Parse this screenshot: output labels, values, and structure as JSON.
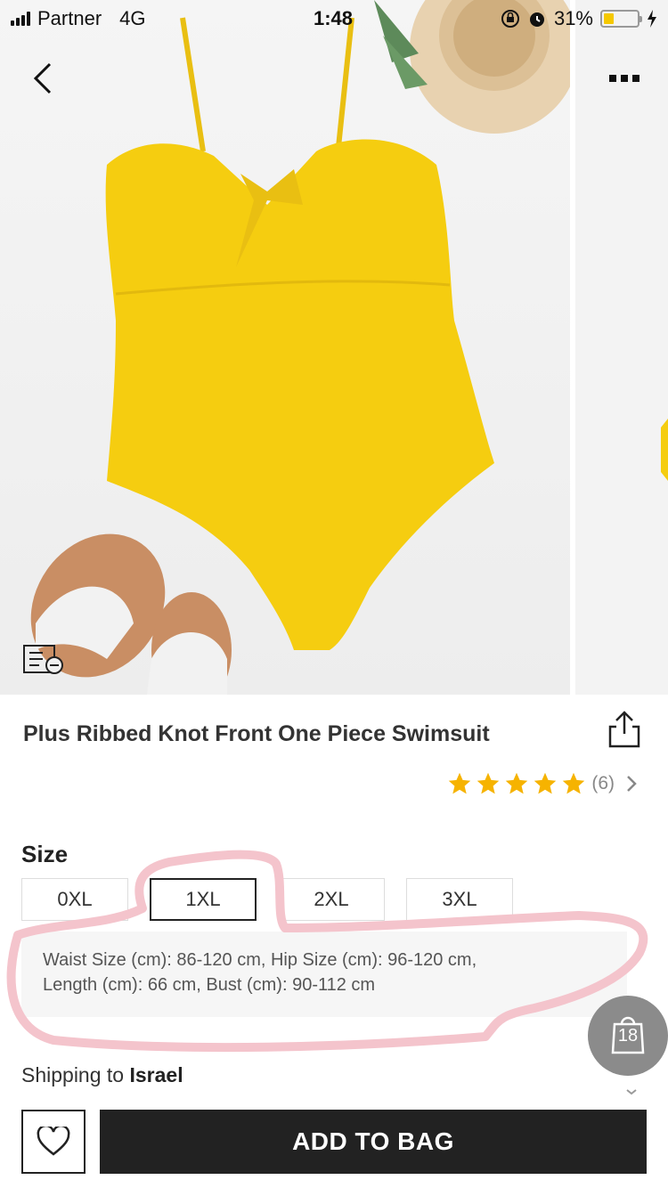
{
  "status_bar": {
    "carrier": "Partner",
    "network": "4G",
    "time": "1:48",
    "battery_percent": "31%",
    "battery_level": 0.31,
    "battery_color": "#f5c800"
  },
  "hero": {
    "back_icon": "chevron-left-icon",
    "more_icon": "more-dots-icon",
    "gallery_icon": "gallery-list-icon",
    "product_color": "#f5cd10"
  },
  "product": {
    "title": "Plus Ribbed Knot Front One Piece Swimsuit",
    "rating_stars": 5,
    "rating_count": "(6)",
    "star_color": "#f6b300"
  },
  "size": {
    "heading": "Size",
    "options": [
      "0XL",
      "1XL",
      "2XL",
      "3XL"
    ],
    "selected": "1XL",
    "description_line1": "Waist Size (cm): 86-120 cm, Hip Size (cm): 96-120 cm,",
    "description_line2": "Length (cm): 66 cm, Bust (cm): 90-112 cm"
  },
  "shipping": {
    "label": "Shipping to",
    "country": "Israel"
  },
  "bag": {
    "count": "18"
  },
  "actions": {
    "add_to_bag": "ADD TO BAG"
  },
  "annotation_color": "#f4c4cc"
}
